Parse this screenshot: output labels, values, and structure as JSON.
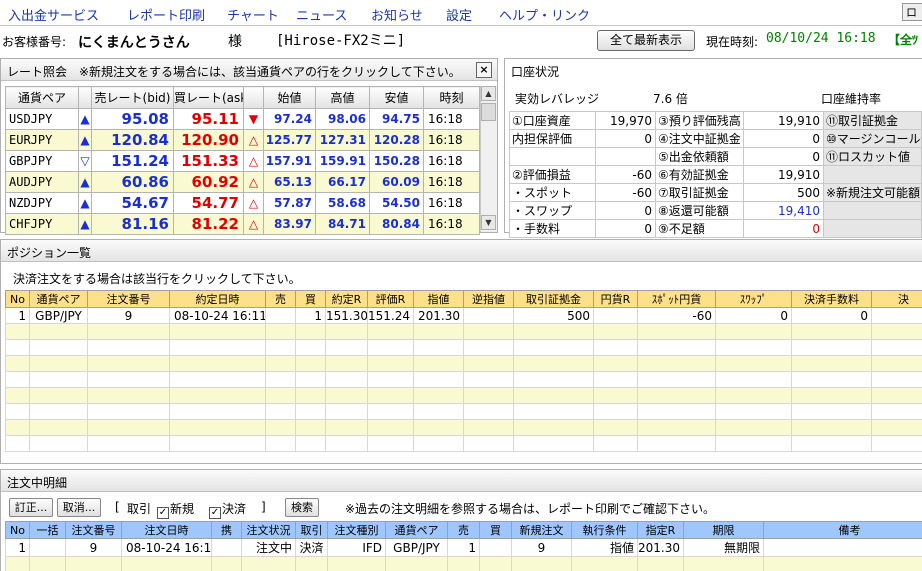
{
  "menu": [
    "入出金サービス",
    "レポート印刷",
    "チャート",
    "ニュース",
    "お知らせ",
    "設定",
    "ヘルプ・リンク",
    "ロ"
  ],
  "customer": {
    "label": "お客様番号:",
    "name": "にくまんとうさん",
    "honorific": "様",
    "account_type": "[Hirose-FX2ミニ]",
    "refresh_button": "全て最新表示",
    "time_label": "現在時刻:",
    "time_value": "08/10/24 16:18",
    "overflow": "【全ﾂ"
  },
  "rates": {
    "title": "レート照会　※新規注文をする場合には、該当通貨ペアの行をクリックして下さい。",
    "close": "×",
    "headers": [
      "通貨ペア",
      "",
      "売レート(bid)",
      "買レート(ask)",
      "",
      "始値",
      "高値",
      "安値",
      "時刻"
    ],
    "rows": [
      {
        "pair": "USDJPY",
        "bid_arrow": "▲",
        "bid_dir": "up",
        "bid": "95.08",
        "ask": "95.11",
        "ask_arrow": "▼",
        "ask_dir": "down",
        "open": "97.24",
        "high": "98.06",
        "low": "94.75",
        "time": "16:18"
      },
      {
        "pair": "EURJPY",
        "bid_arrow": "▲",
        "bid_dir": "up",
        "bid": "120.84",
        "ask": "120.90",
        "ask_arrow": "△",
        "ask_dir": "up-red",
        "open": "125.77",
        "high": "127.31",
        "low": "120.28",
        "time": "16:18"
      },
      {
        "pair": "GBPJPY",
        "bid_arrow": "▽",
        "bid_dir": "down-blue",
        "bid": "151.24",
        "ask": "151.33",
        "ask_arrow": "△",
        "ask_dir": "up-red",
        "open": "157.91",
        "high": "159.91",
        "low": "150.28",
        "time": "16:18"
      },
      {
        "pair": "AUDJPY",
        "bid_arrow": "▲",
        "bid_dir": "up",
        "bid": "60.86",
        "ask": "60.92",
        "ask_arrow": "△",
        "ask_dir": "up-red",
        "open": "65.13",
        "high": "66.17",
        "low": "60.09",
        "time": "16:18"
      },
      {
        "pair": "NZDJPY",
        "bid_arrow": "▲",
        "bid_dir": "up",
        "bid": "54.67",
        "ask": "54.77",
        "ask_arrow": "△",
        "ask_dir": "up-red",
        "open": "57.87",
        "high": "58.68",
        "low": "54.50",
        "time": "16:18"
      },
      {
        "pair": "CHFJPY",
        "bid_arrow": "▲",
        "bid_dir": "up",
        "bid": "81.16",
        "ask": "81.22",
        "ask_arrow": "△",
        "ask_dir": "up-red",
        "open": "83.97",
        "high": "84.71",
        "low": "80.84",
        "time": "16:18"
      }
    ]
  },
  "account": {
    "title": "口座状況",
    "leverage_label": "実効レバレッジ",
    "leverage_value": "7.6 倍",
    "maintenance_label": "口座維持率",
    "rows": [
      [
        "①口座資産",
        "19,970",
        "③預り評価残高",
        "19,910",
        "⑪取引証拠金"
      ],
      [
        "内担保評価",
        "0",
        "④注文中証拠金",
        "0",
        "⑩マージンコール値"
      ],
      [
        "",
        "",
        "⑤出金依頼額",
        "0",
        "⑪ロスカット値"
      ],
      [
        "②評価損益",
        "-60",
        "⑥有効証拠金",
        "19,910",
        ""
      ],
      [
        "・スポット",
        "-60",
        "⑦取引証拠金",
        "500",
        "※新規注文可能額"
      ],
      [
        "・スワップ",
        "0",
        "⑧返還可能額",
        "19,410",
        ""
      ],
      [
        "・手数料",
        "0",
        "⑨不足額",
        "0",
        ""
      ]
    ]
  },
  "positions": {
    "title": "ポジション一覧",
    "hint": "決済注文をする場合は該当行をクリックして下さい。",
    "headers": [
      "No",
      "通貨ペア",
      "注文番号",
      "約定日時",
      "売",
      "買",
      "約定R",
      "評価R",
      "指値",
      "逆指値",
      "取引証拠金",
      "円貨R",
      "ｽﾎﾟｯﾄ円貨",
      "ｽﾜｯﾌﾟ",
      "決済手数料",
      "決"
    ],
    "rows": [
      [
        "1",
        "GBP/JPY",
        "9",
        "08-10-24 16:11",
        "",
        "1",
        "151.30",
        "151.24",
        "201.30",
        "",
        "500",
        "",
        "-60",
        "0",
        "0",
        ""
      ]
    ]
  },
  "orders": {
    "title": "注文中明細",
    "correct_button": "訂正...",
    "cancel_button": "取消...",
    "filter_open": "[",
    "filter_trade": "取引",
    "filter_new": "新規",
    "filter_settle": "決済",
    "filter_close": "]",
    "check_mark": "✓",
    "search_button": "検索",
    "hint": "※過去の注文明細を参照する場合は、レポート印刷でご確認下さい。",
    "headers": [
      "No",
      "一括",
      "注文番号",
      "注文日時",
      "携",
      "注文状況",
      "取引",
      "注文種別",
      "通貨ペア",
      "売",
      "買",
      "新規注文",
      "執行条件",
      "指定R",
      "期限",
      "備考"
    ],
    "rows": [
      [
        "1",
        "",
        "9",
        "08-10-24 16:11",
        "",
        "注文中",
        "決済",
        "IFD",
        "GBP/JPY",
        "1",
        "",
        "9",
        "指値",
        "201.30",
        "無期限",
        ""
      ]
    ]
  }
}
